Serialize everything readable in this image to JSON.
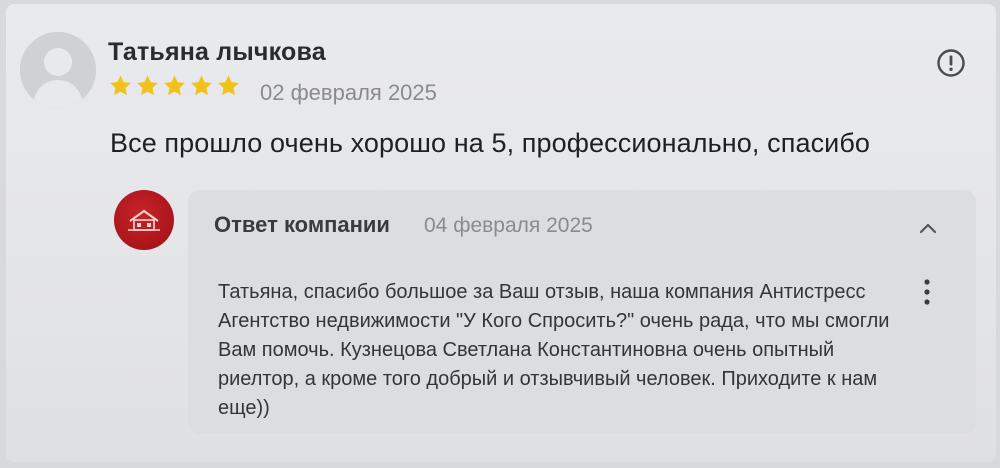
{
  "review": {
    "author": "Татьяна лычкова",
    "rating": 5,
    "rating_max": 5,
    "date": "02 февраля 2025",
    "text": "Все прошло очень хорошо на 5, профессионально, спасибо"
  },
  "reply": {
    "label": "Ответ компании",
    "date": "04 февраля 2025",
    "text": "Татьяна, спасибо большое за Ваш отзыв, наша компания Антистресс Агентство недвижимости \"У Кого Спросить?\" очень рада, что мы смогли Вам помочь. Кузнецова Светлана Константиновна очень опытный риелтор, а кроме того добрый и отзывчивый человек. Приходите к нам еще))"
  },
  "icons": {
    "avatar": "user-silhouette-icon",
    "star": "star-icon",
    "report": "exclamation-circle-icon",
    "company_logo": "house-logo-icon",
    "collapse": "chevron-up-icon",
    "more": "vertical-dots-icon"
  },
  "colors": {
    "star": "#f0c21b",
    "company_logo": "#b31a20",
    "muted_text": "#8a8b8f"
  }
}
